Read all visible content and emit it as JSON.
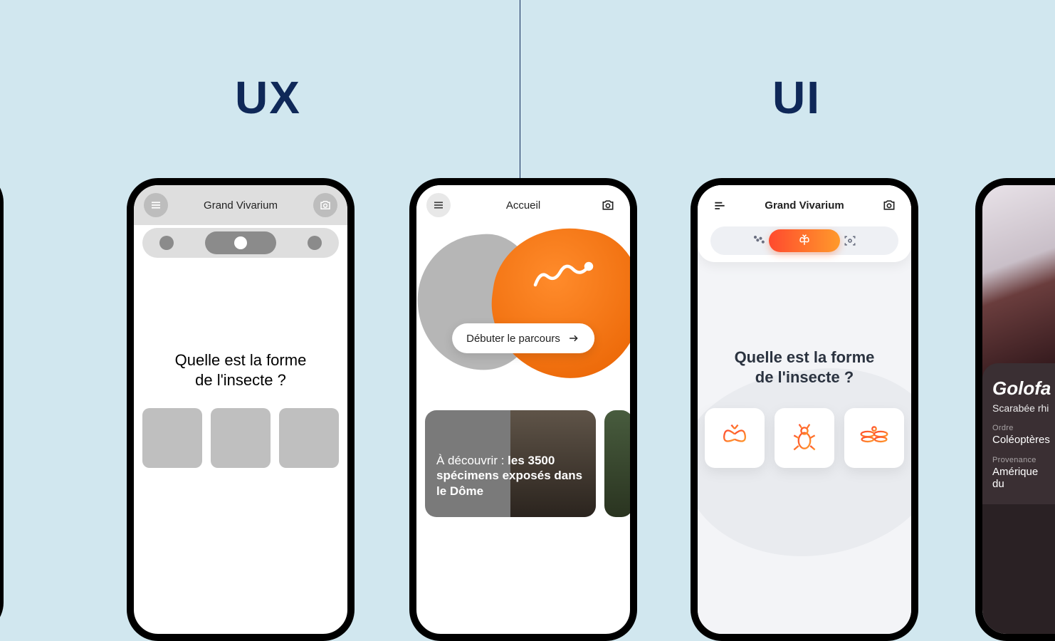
{
  "headings": {
    "ux": "UX",
    "ui": "UI"
  },
  "wireframe_phone": {
    "title": "Grand Vivarium",
    "question": "Quelle est la forme\nde l'insecte ?"
  },
  "accueil_phone": {
    "title": "Accueil",
    "cta": "Débuter le parcours",
    "card1_prefix": "À découvrir : ",
    "card1_bold": "les 3500 spécimens exposés dans le Dôme"
  },
  "ui_phone": {
    "title": "Grand Vivarium",
    "question": "Quelle est la forme\nde l'insecte ?"
  },
  "detail_phone": {
    "name": "Golofa",
    "subtitle": "Scarabée rhi",
    "order_label": "Ordre",
    "order_value": "Coléoptères",
    "prov_label": "Provenance",
    "prov_value": "Amérique du"
  }
}
